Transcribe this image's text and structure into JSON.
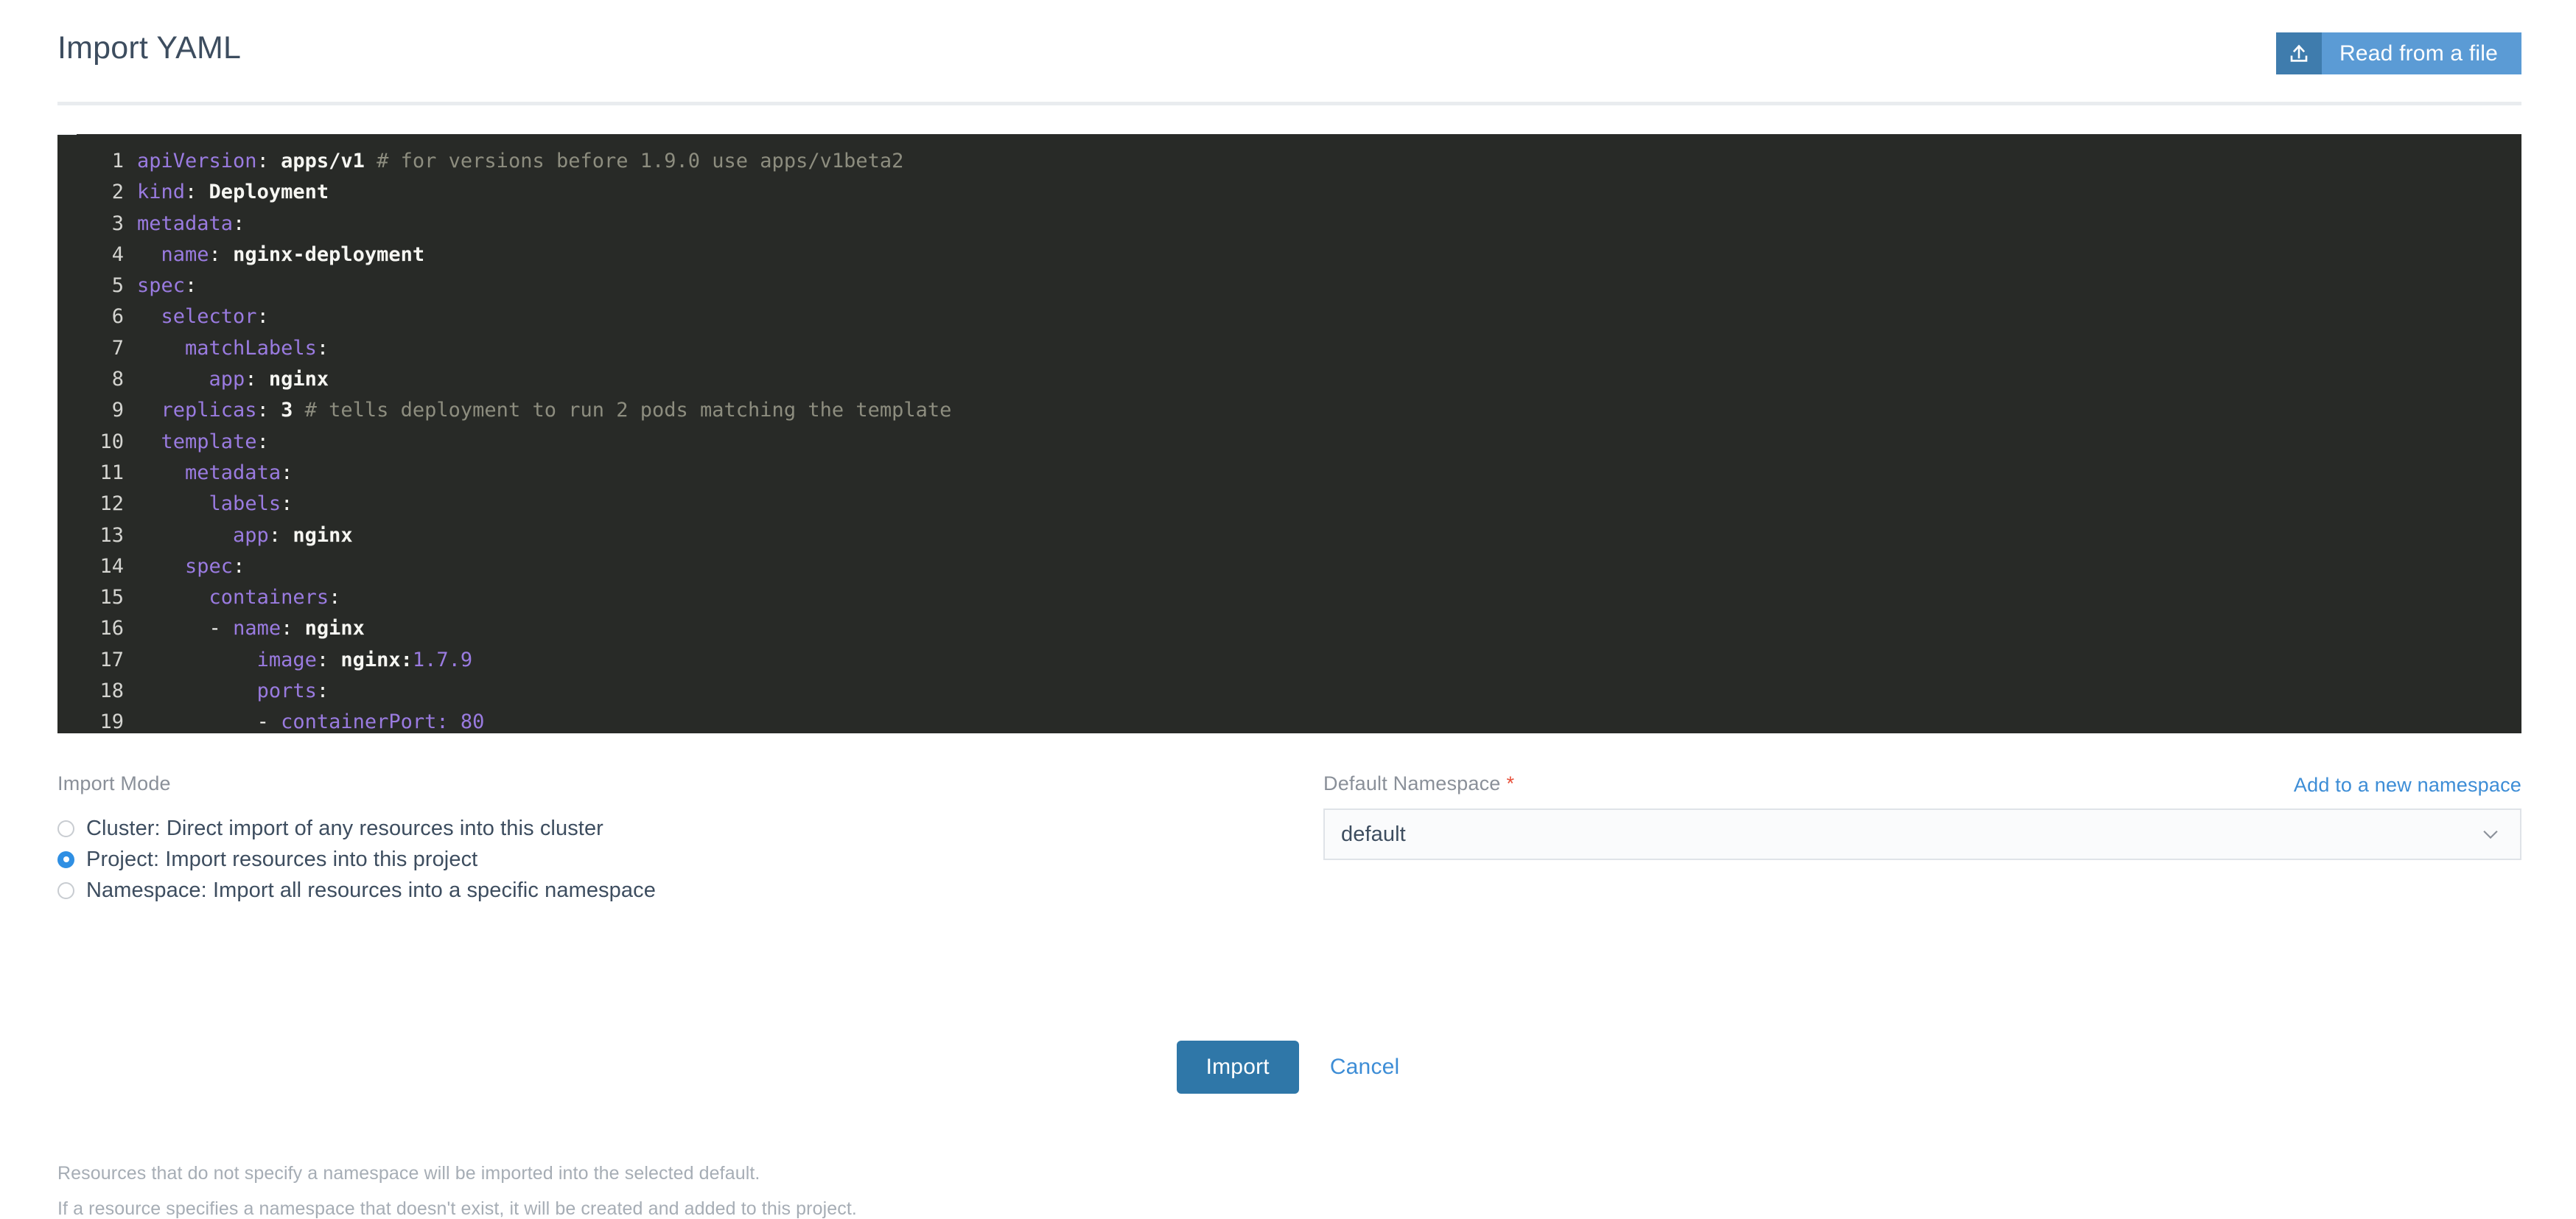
{
  "header": {
    "title": "Import YAML",
    "read_from_file_label": "Read from a file",
    "upload_icon": "upload-icon"
  },
  "editor": {
    "language": "yaml",
    "colors": {
      "background": "#282a27",
      "key": "#9a7be0",
      "value": "#f6f6f2",
      "comment": "#8d8d7f",
      "line_number": "#d4d4d0"
    },
    "lines": [
      {
        "n": "1",
        "indent": 0,
        "key": "apiVersion",
        "value": "apps/v1",
        "value_kind": "string",
        "comment": "# for versions before 1.9.0 use apps/v1beta2"
      },
      {
        "n": "2",
        "indent": 0,
        "key": "kind",
        "value": "Deployment",
        "value_kind": "string",
        "comment": ""
      },
      {
        "n": "3",
        "indent": 0,
        "key": "metadata",
        "value": "",
        "value_kind": "none",
        "comment": ""
      },
      {
        "n": "4",
        "indent": 1,
        "key": "name",
        "value": "nginx-deployment",
        "value_kind": "string",
        "comment": ""
      },
      {
        "n": "5",
        "indent": 0,
        "key": "spec",
        "value": "",
        "value_kind": "none",
        "comment": ""
      },
      {
        "n": "6",
        "indent": 1,
        "key": "selector",
        "value": "",
        "value_kind": "none",
        "comment": ""
      },
      {
        "n": "7",
        "indent": 2,
        "key": "matchLabels",
        "value": "",
        "value_kind": "none",
        "comment": ""
      },
      {
        "n": "8",
        "indent": 3,
        "key": "app",
        "value": "nginx",
        "value_kind": "string",
        "comment": ""
      },
      {
        "n": "9",
        "indent": 1,
        "key": "replicas",
        "value": "3",
        "value_kind": "string",
        "comment": "# tells deployment to run 2 pods matching the template"
      },
      {
        "n": "10",
        "indent": 1,
        "key": "template",
        "value": "",
        "value_kind": "none",
        "comment": ""
      },
      {
        "n": "11",
        "indent": 2,
        "key": "metadata",
        "value": "",
        "value_kind": "none",
        "comment": ""
      },
      {
        "n": "12",
        "indent": 3,
        "key": "labels",
        "value": "",
        "value_kind": "none",
        "comment": ""
      },
      {
        "n": "13",
        "indent": 4,
        "key": "app",
        "value": "nginx",
        "value_kind": "string",
        "comment": ""
      },
      {
        "n": "14",
        "indent": 2,
        "key": "spec",
        "value": "",
        "value_kind": "none",
        "comment": ""
      },
      {
        "n": "15",
        "indent": 3,
        "key": "containers",
        "value": "",
        "value_kind": "none",
        "comment": ""
      },
      {
        "n": "16",
        "indent": 3,
        "dash": true,
        "key": "name",
        "value": "nginx",
        "value_kind": "string",
        "comment": ""
      },
      {
        "n": "17",
        "indent": 5,
        "key": "image",
        "value": "nginx:",
        "value_kind": "string",
        "value_tail": "1.7.9",
        "comment": ""
      },
      {
        "n": "18",
        "indent": 5,
        "key": "ports",
        "value": "",
        "value_kind": "none",
        "comment": ""
      },
      {
        "n": "19",
        "indent": 5,
        "dash": true,
        "key": "containerPort",
        "value": "80",
        "value_kind": "number",
        "comment": ""
      }
    ],
    "raw_text": "apiVersion: apps/v1 # for versions before 1.9.0 use apps/v1beta2\nkind: Deployment\nmetadata:\n  name: nginx-deployment\nspec:\n  selector:\n    matchLabels:\n      app: nginx\n  replicas: 3 # tells deployment to run 2 pods matching the template\n  template:\n    metadata:\n      labels:\n        app: nginx\n    spec:\n      containers:\n      - name: nginx\n        image: nginx:1.7.9\n        ports:\n        - containerPort: 80"
  },
  "import_mode": {
    "label": "Import Mode",
    "options": [
      {
        "id": "cluster",
        "label": "Cluster: Direct import of any resources into this cluster",
        "selected": false
      },
      {
        "id": "project",
        "label": "Project: Import resources into this project",
        "selected": true
      },
      {
        "id": "namespace",
        "label": "Namespace: Import all resources into a specific namespace",
        "selected": false
      }
    ],
    "helper_lines": [
      "Resources that do not specify a namespace will be imported into the selected default.",
      "If a resource specifies a namespace that doesn't exist, it will be created and added to this project."
    ]
  },
  "default_namespace": {
    "label": "Default Namespace",
    "required_marker": "*",
    "add_link": "Add to a new namespace",
    "selected_value": "default",
    "chevron_icon": "chevron-down-icon"
  },
  "footer": {
    "import_label": "Import",
    "cancel_label": "Cancel"
  },
  "colors": {
    "accent_blue": "#5b9bd5",
    "accent_blue_dark": "#3f7cad",
    "primary_button": "#2f77a8",
    "link": "#3d8dd6",
    "required": "#e8503a",
    "radio_selected": "#2f8fe3"
  }
}
